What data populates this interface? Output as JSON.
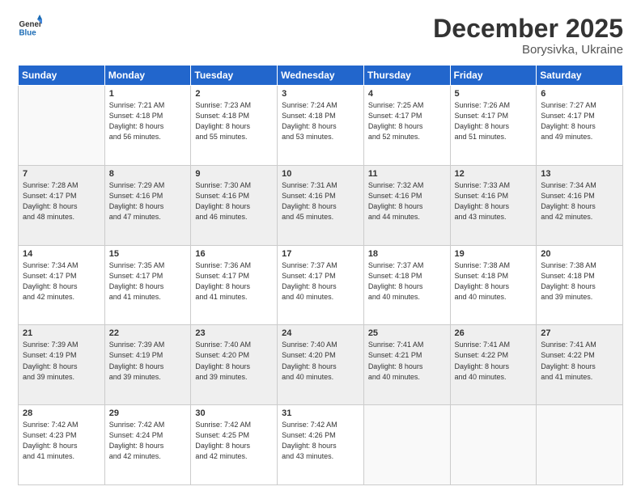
{
  "header": {
    "logo_general": "General",
    "logo_blue": "Blue",
    "month_year": "December 2025",
    "location": "Borysivka, Ukraine"
  },
  "weekdays": [
    "Sunday",
    "Monday",
    "Tuesday",
    "Wednesday",
    "Thursday",
    "Friday",
    "Saturday"
  ],
  "weeks": [
    [
      {
        "day": "",
        "info": ""
      },
      {
        "day": "1",
        "info": "Sunrise: 7:21 AM\nSunset: 4:18 PM\nDaylight: 8 hours\nand 56 minutes."
      },
      {
        "day": "2",
        "info": "Sunrise: 7:23 AM\nSunset: 4:18 PM\nDaylight: 8 hours\nand 55 minutes."
      },
      {
        "day": "3",
        "info": "Sunrise: 7:24 AM\nSunset: 4:18 PM\nDaylight: 8 hours\nand 53 minutes."
      },
      {
        "day": "4",
        "info": "Sunrise: 7:25 AM\nSunset: 4:17 PM\nDaylight: 8 hours\nand 52 minutes."
      },
      {
        "day": "5",
        "info": "Sunrise: 7:26 AM\nSunset: 4:17 PM\nDaylight: 8 hours\nand 51 minutes."
      },
      {
        "day": "6",
        "info": "Sunrise: 7:27 AM\nSunset: 4:17 PM\nDaylight: 8 hours\nand 49 minutes."
      }
    ],
    [
      {
        "day": "7",
        "info": "Sunrise: 7:28 AM\nSunset: 4:17 PM\nDaylight: 8 hours\nand 48 minutes."
      },
      {
        "day": "8",
        "info": "Sunrise: 7:29 AM\nSunset: 4:16 PM\nDaylight: 8 hours\nand 47 minutes."
      },
      {
        "day": "9",
        "info": "Sunrise: 7:30 AM\nSunset: 4:16 PM\nDaylight: 8 hours\nand 46 minutes."
      },
      {
        "day": "10",
        "info": "Sunrise: 7:31 AM\nSunset: 4:16 PM\nDaylight: 8 hours\nand 45 minutes."
      },
      {
        "day": "11",
        "info": "Sunrise: 7:32 AM\nSunset: 4:16 PM\nDaylight: 8 hours\nand 44 minutes."
      },
      {
        "day": "12",
        "info": "Sunrise: 7:33 AM\nSunset: 4:16 PM\nDaylight: 8 hours\nand 43 minutes."
      },
      {
        "day": "13",
        "info": "Sunrise: 7:34 AM\nSunset: 4:16 PM\nDaylight: 8 hours\nand 42 minutes."
      }
    ],
    [
      {
        "day": "14",
        "info": "Sunrise: 7:34 AM\nSunset: 4:17 PM\nDaylight: 8 hours\nand 42 minutes."
      },
      {
        "day": "15",
        "info": "Sunrise: 7:35 AM\nSunset: 4:17 PM\nDaylight: 8 hours\nand 41 minutes."
      },
      {
        "day": "16",
        "info": "Sunrise: 7:36 AM\nSunset: 4:17 PM\nDaylight: 8 hours\nand 41 minutes."
      },
      {
        "day": "17",
        "info": "Sunrise: 7:37 AM\nSunset: 4:17 PM\nDaylight: 8 hours\nand 40 minutes."
      },
      {
        "day": "18",
        "info": "Sunrise: 7:37 AM\nSunset: 4:18 PM\nDaylight: 8 hours\nand 40 minutes."
      },
      {
        "day": "19",
        "info": "Sunrise: 7:38 AM\nSunset: 4:18 PM\nDaylight: 8 hours\nand 40 minutes."
      },
      {
        "day": "20",
        "info": "Sunrise: 7:38 AM\nSunset: 4:18 PM\nDaylight: 8 hours\nand 39 minutes."
      }
    ],
    [
      {
        "day": "21",
        "info": "Sunrise: 7:39 AM\nSunset: 4:19 PM\nDaylight: 8 hours\nand 39 minutes."
      },
      {
        "day": "22",
        "info": "Sunrise: 7:39 AM\nSunset: 4:19 PM\nDaylight: 8 hours\nand 39 minutes."
      },
      {
        "day": "23",
        "info": "Sunrise: 7:40 AM\nSunset: 4:20 PM\nDaylight: 8 hours\nand 39 minutes."
      },
      {
        "day": "24",
        "info": "Sunrise: 7:40 AM\nSunset: 4:20 PM\nDaylight: 8 hours\nand 40 minutes."
      },
      {
        "day": "25",
        "info": "Sunrise: 7:41 AM\nSunset: 4:21 PM\nDaylight: 8 hours\nand 40 minutes."
      },
      {
        "day": "26",
        "info": "Sunrise: 7:41 AM\nSunset: 4:22 PM\nDaylight: 8 hours\nand 40 minutes."
      },
      {
        "day": "27",
        "info": "Sunrise: 7:41 AM\nSunset: 4:22 PM\nDaylight: 8 hours\nand 41 minutes."
      }
    ],
    [
      {
        "day": "28",
        "info": "Sunrise: 7:42 AM\nSunset: 4:23 PM\nDaylight: 8 hours\nand 41 minutes."
      },
      {
        "day": "29",
        "info": "Sunrise: 7:42 AM\nSunset: 4:24 PM\nDaylight: 8 hours\nand 42 minutes."
      },
      {
        "day": "30",
        "info": "Sunrise: 7:42 AM\nSunset: 4:25 PM\nDaylight: 8 hours\nand 42 minutes."
      },
      {
        "day": "31",
        "info": "Sunrise: 7:42 AM\nSunset: 4:26 PM\nDaylight: 8 hours\nand 43 minutes."
      },
      {
        "day": "",
        "info": ""
      },
      {
        "day": "",
        "info": ""
      },
      {
        "day": "",
        "info": ""
      }
    ]
  ]
}
